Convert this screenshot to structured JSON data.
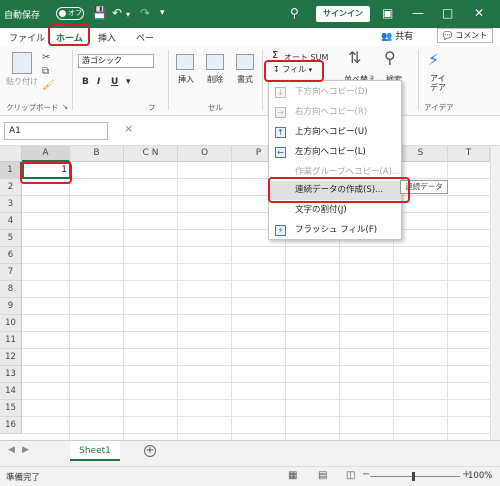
{
  "titlebar": {
    "autosave_label": "自動保存",
    "toggle_state": "オフ",
    "signin_label": "サインイン"
  },
  "ribbon_tabs": {
    "file": "ファイル",
    "home": "ホーム",
    "insert": "挿入",
    "page": "ペー",
    "share": "共有",
    "comment": "コメント"
  },
  "ribbon": {
    "paste_label": "貼り付け",
    "clipboard_label": "クリップボード",
    "font_name": "游ゴシック",
    "bold": "B",
    "italic": "I",
    "underline": "U",
    "font_group_label": "フ",
    "insert_label": "挿入",
    "delete_label": "削除",
    "format_label": "書式",
    "cells_label": "セル",
    "autosum_label": "オート SUM",
    "sort_label": "並べ替え",
    "find_label": "検索",
    "ideas_label": "アイ\nデア",
    "ideas_group_label": "アイデア",
    "fill_label": "フィル"
  },
  "formula_bar": {
    "namebox": "A1",
    "cancel": "×"
  },
  "columns": [
    "A",
    "B",
    "C N",
    "O",
    "P",
    "Q",
    "R",
    "S",
    "T"
  ],
  "rows": [
    "1",
    "2",
    "3",
    "4",
    "5",
    "6",
    "7",
    "8",
    "9",
    "10",
    "11",
    "12",
    "13",
    "14",
    "15",
    "16"
  ],
  "cell_a1_value": "1",
  "fill_menu": {
    "items": [
      {
        "label": "下方向へコピー(D)",
        "disabled": true
      },
      {
        "label": "右方向へコピー(R)",
        "disabled": true
      },
      {
        "label": "上方向へコピー(U)",
        "disabled": false
      },
      {
        "label": "左方向へコピー(L)",
        "disabled": false
      },
      {
        "label": "作業グループへコピー(A)...",
        "disabled": true
      },
      {
        "label": "連続データの作成(S)...",
        "disabled": false
      },
      {
        "label": "文字の割付(J)",
        "disabled": false
      },
      {
        "label": "フラッシュ フィル(F)",
        "disabled": false
      }
    ],
    "tooltip": "連続データ"
  },
  "sheets": {
    "active": "Sheet1"
  },
  "status": {
    "ready": "準備完了",
    "zoom": "100%"
  },
  "colors": {
    "excel_green": "#217346",
    "annotation_red": "#d71f2b"
  }
}
